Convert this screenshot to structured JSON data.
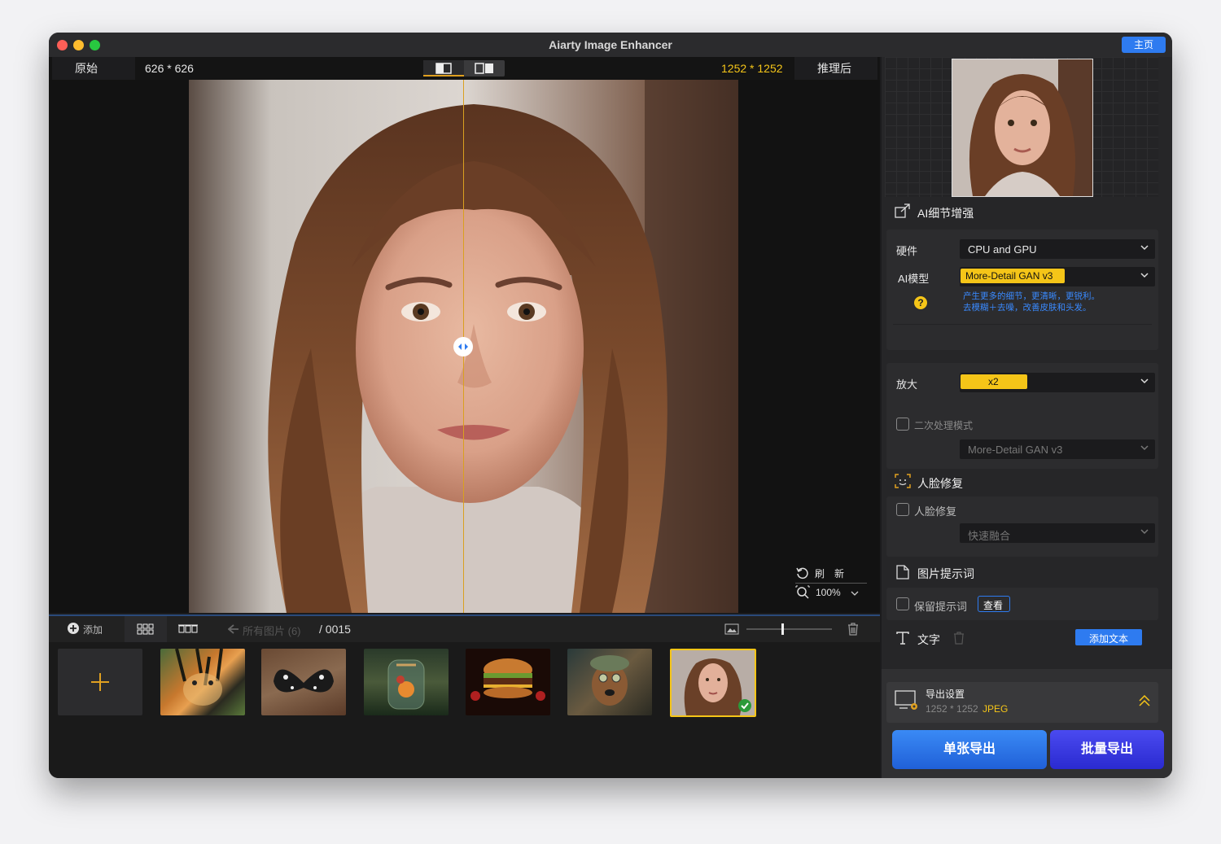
{
  "window": {
    "title": "Aiarty Image Enhancer",
    "home_label": "主页"
  },
  "topbar": {
    "original_label": "原始",
    "original_size": "626 * 626",
    "enhanced_size": "1252 * 1252",
    "enhanced_label": "推理后"
  },
  "viewer": {
    "refresh_label": "刷　新",
    "zoom_level": "100%"
  },
  "strip": {
    "add_label": "添加",
    "all_images_label": "所有图片 (6)",
    "count_label": "/ 0015",
    "thumbnails": [
      "tiger",
      "butterfly",
      "jar-scene",
      "burger",
      "dog",
      "portrait"
    ],
    "selected_index": 5
  },
  "sidebar": {
    "detail_title": "AI细节增强",
    "hardware_label": "硬件",
    "hardware_value": "CPU and GPU",
    "model_label": "AI模型",
    "model_value": "More-Detail GAN v3",
    "model_desc_1": "产生更多的细节，更清晰，更锐利。",
    "model_desc_2": "去模糊＋去噪，改善皮肤和头发。",
    "upscale_label": "放大",
    "upscale_value": "x2",
    "secondary_label": "二次处理模式",
    "secondary_value": "More-Detail GAN v3",
    "face_title": "人脸修复",
    "face_checkbox_label": "人脸修复",
    "face_mode_value": "快速融合",
    "prompt_title": "图片提示词",
    "keep_prompt_label": "保留提示词",
    "view_label": "查看",
    "text_title": "文字",
    "add_text_label": "添加文本",
    "export_title": "导出设置",
    "export_size": "1252 * 1252",
    "export_format": "JPEG",
    "single_export_label": "单张导出",
    "batch_export_label": "批量导出"
  },
  "colors": {
    "accent_blue": "#2e7bf0",
    "highlight_yellow": "#f5c518"
  }
}
